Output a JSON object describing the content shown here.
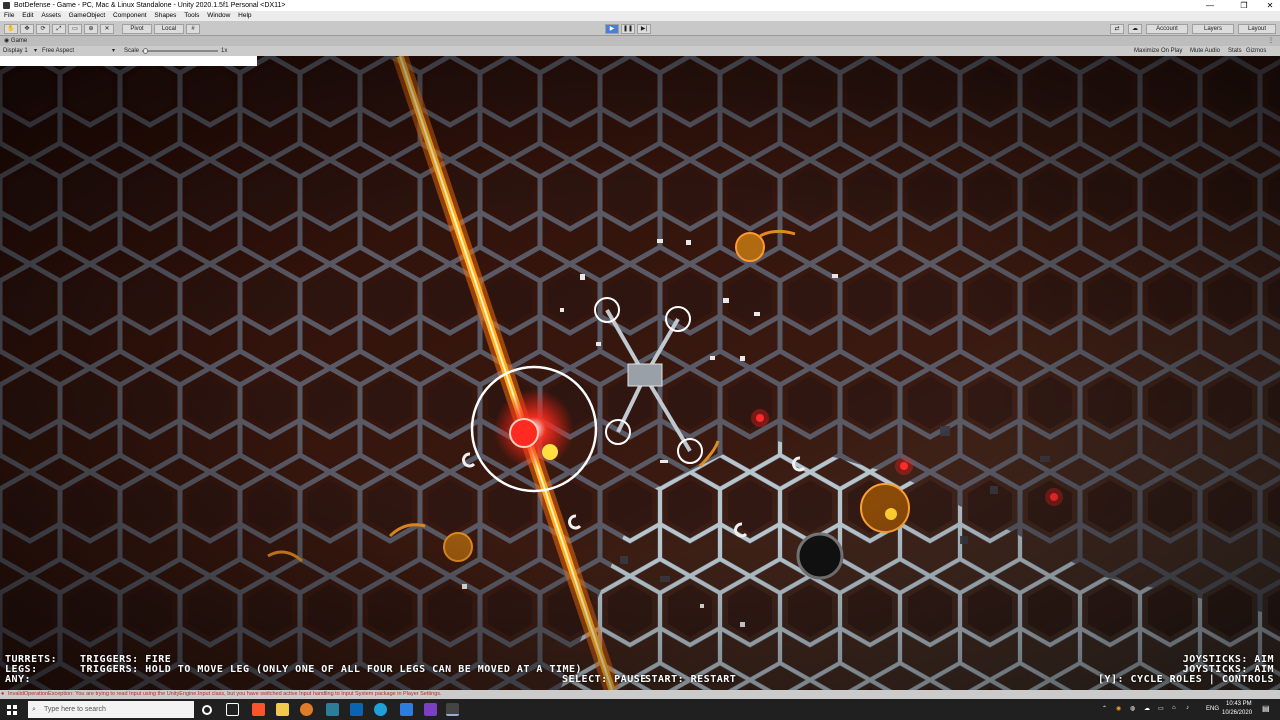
{
  "window": {
    "title": "BotDefense - Game - PC, Mac & Linux Standalone - Unity 2020.1.5f1 Personal <DX11>",
    "minimize": "—",
    "maximize": "❐",
    "close": "✕"
  },
  "menu": [
    "File",
    "Edit",
    "Assets",
    "GameObject",
    "Component",
    "Shapes",
    "Tools",
    "Window",
    "Help"
  ],
  "toolbar": {
    "pivot": "Pivot",
    "local": "Local",
    "account": "Account",
    "layers": "Layers",
    "layout": "Layout",
    "play_icon": "play-icon",
    "pause_icon": "pause-icon",
    "step_icon": "step-icon"
  },
  "game_view": {
    "tab": "Game",
    "display": "Display 1",
    "aspect": "Free Aspect",
    "scale_label": "Scale",
    "scale_value": "1x",
    "maximize_on_play": "Maximize On Play",
    "mute_audio": "Mute Audio",
    "stats": "Stats",
    "gizmos": "Gizmos"
  },
  "hud": {
    "turrets_label": "TURRETS:",
    "turrets_text": "TRIGGERS: FIRE",
    "legs_label": "LEGS:",
    "legs_text": "TRIGGERS: HOLD TO MOVE LEG (ONLY ONE OF ALL FOUR LEGS CAN BE MOVED AT A TIME)",
    "any_label": "ANY:",
    "select_text": "SELECT: PAUSE",
    "start_text": "START: RESTART",
    "right_line1": "JOYSTICKS: AIM",
    "right_line2": "JOYSTICKS: AIM",
    "right_line3": "[Y]: CYCLE ROLES | CONTROLS"
  },
  "console_error": "InvalidOperationException: You are trying to read Input using the UnityEngine.Input class, but you have switched active Input handling to Input System package in Player Settings.",
  "taskbar": {
    "search_placeholder": "Type here to search",
    "language": "ENG",
    "time": "10:43 PM",
    "date": "10/26/2020"
  },
  "colors": {
    "laser": "#ffb020",
    "enemy_red": "#ff2020",
    "hex_lit": "#c8d8e0",
    "background": "#1a0a06"
  }
}
